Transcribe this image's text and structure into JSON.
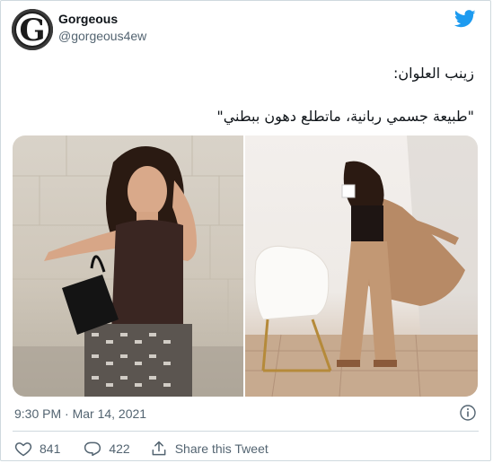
{
  "tweet": {
    "author": {
      "display_name": "Gorgeous",
      "handle": "@gorgeous4ew",
      "avatar_letter": "G"
    },
    "text_lines": [
      "زينب العلوان:",
      "\"طبيعة جسمي ربانية، ماتطلع دهون ببطني\""
    ],
    "timestamp": "9:30 PM · Mar 14, 2021",
    "actions": {
      "like_count": "841",
      "reply_count": "422",
      "share_label": "Share this Tweet"
    },
    "media_count": 2
  },
  "colors": {
    "twitter_blue": "#1d9bf0",
    "secondary_text": "#536471",
    "border": "#cfd9de"
  },
  "icons": [
    "twitter-bird-icon",
    "info-icon",
    "heart-icon",
    "reply-icon",
    "share-icon"
  ]
}
